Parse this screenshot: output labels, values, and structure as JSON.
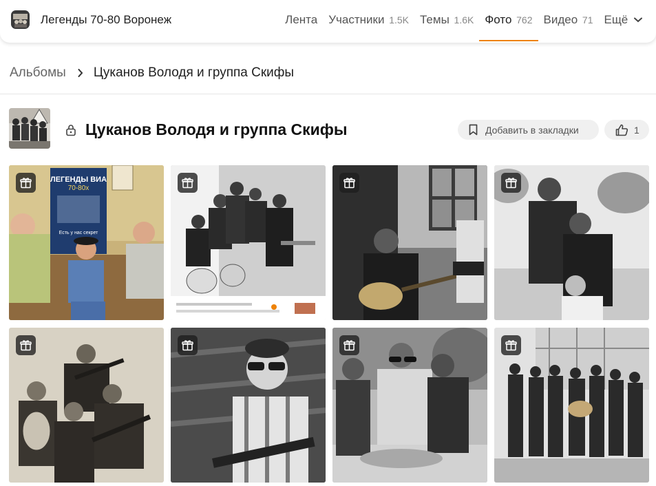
{
  "header": {
    "group_title": "Легенды 70-80 Воронеж",
    "nav": [
      {
        "label": "Лента",
        "count": ""
      },
      {
        "label": "Участники",
        "count": "1.5K"
      },
      {
        "label": "Темы",
        "count": "1.6K"
      },
      {
        "label": "Фото",
        "count": "762",
        "active": true
      },
      {
        "label": "Видео",
        "count": "71"
      },
      {
        "label": "Ещё",
        "count": ""
      }
    ]
  },
  "breadcrumb": {
    "root": "Альбомы",
    "current": "Цуканов Володя и группа Скифы"
  },
  "album": {
    "title": "Цуканов Володя и группа Скифы",
    "bookmark_label": "Добавить в закладки",
    "like_count": "1"
  },
  "photos": [
    {
      "poster_title": "ЛЕГЕНДЫ ВИА",
      "poster_sub": "70-80х",
      "poster_line": "Есть у нас секрет",
      "tone": "color"
    },
    {
      "tone": "bw"
    },
    {
      "tone": "bw"
    },
    {
      "tone": "bw"
    },
    {
      "tone": "sepia"
    },
    {
      "tone": "bw"
    },
    {
      "tone": "bw"
    },
    {
      "tone": "bw"
    }
  ],
  "icons": {
    "gift": "gift-icon",
    "lock": "lock-icon",
    "bookmark": "bookmark-icon",
    "like": "thumbs-up-icon",
    "chevron": "chevron-down-icon"
  },
  "colors": {
    "accent": "#ee8208"
  }
}
